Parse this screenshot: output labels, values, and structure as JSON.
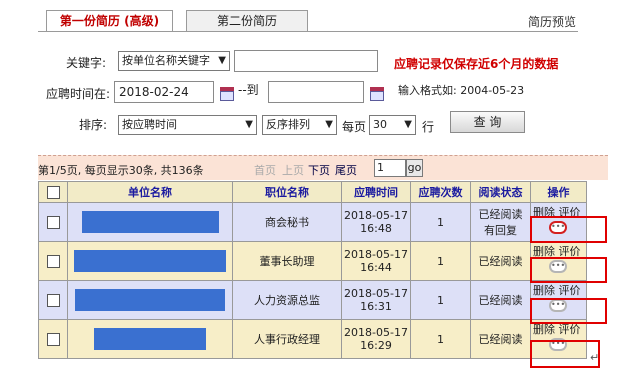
{
  "tabs": [
    {
      "label": "第一份简历 (高级)",
      "active": true
    },
    {
      "label": "第二份简历",
      "active": false
    }
  ],
  "preview_link": "简历预览",
  "search": {
    "keyword_label": "关键字:",
    "keyword_select": "按单位名称关键字",
    "keyword_value": "",
    "note": "应聘记录仅保存近6个月的数据",
    "date_label": "应聘时间在:",
    "date_from": "2018-02-24",
    "date_sep": "--到",
    "date_to": "",
    "format_hint": "输入格式如: 2004-05-23",
    "sort_label": "排序:",
    "sort_field": "按应聘时间",
    "sort_order": "反序排列",
    "per_page_label": "每页",
    "per_page": "30",
    "rows_label": "行",
    "query_button": "查 询"
  },
  "pager": {
    "summary": "第1/5页, 每页显示30条, 共136条",
    "first": "首页",
    "prev": "上页",
    "next": "下页",
    "last": "尾页",
    "page_input": "1",
    "go": "go"
  },
  "table": {
    "headers": [
      "",
      "单位名称",
      "职位名称",
      "应聘时间",
      "应聘次数",
      "阅读状态",
      "操作"
    ],
    "delete_label": "删除",
    "eval_label": "评价",
    "rows": [
      {
        "position": "商会秘书",
        "date": "2018-05-17",
        "time": "16:48",
        "count": "1",
        "status": "已经阅读",
        "status2": "有回复"
      },
      {
        "position": "董事长助理",
        "date": "2018-05-17",
        "time": "16:44",
        "count": "1",
        "status": "已经阅读",
        "status2": ""
      },
      {
        "position": "人力资源总监",
        "date": "2018-05-17",
        "time": "16:31",
        "count": "1",
        "status": "已经阅读",
        "status2": ""
      },
      {
        "position": "人事行政经理",
        "date": "2018-05-17",
        "time": "16:29",
        "count": "1",
        "status": "已经阅读",
        "status2": ""
      }
    ]
  },
  "icons": {
    "comment_bubble": "comment-bubble-icon",
    "calendar": "calendar-icon"
  },
  "colors": {
    "accent_red": "#d00000",
    "row_blue": "#dde0f7",
    "row_yellow": "#f7eec8",
    "header_bg": "#f2ebc7",
    "redaction": "#3a70d0"
  }
}
